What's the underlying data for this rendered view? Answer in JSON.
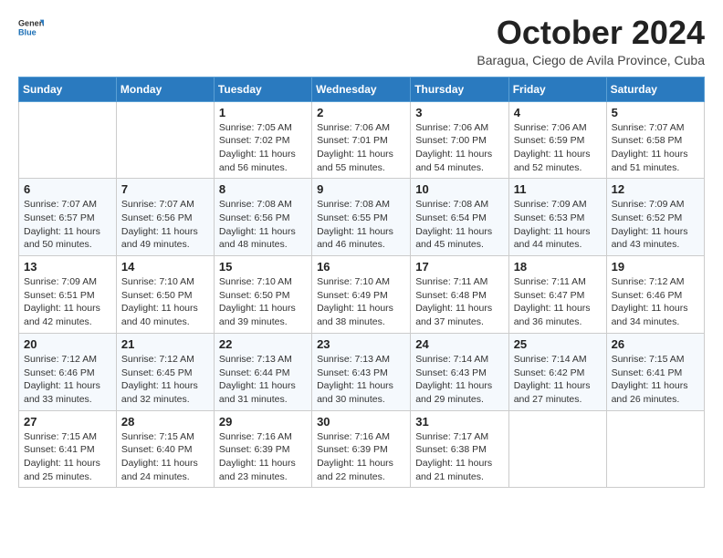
{
  "header": {
    "logo_general": "General",
    "logo_blue": "Blue",
    "title": "October 2024",
    "subtitle": "Baragua, Ciego de Avila Province, Cuba"
  },
  "days_of_week": [
    "Sunday",
    "Monday",
    "Tuesday",
    "Wednesday",
    "Thursday",
    "Friday",
    "Saturday"
  ],
  "weeks": [
    [
      {
        "day": "",
        "info": ""
      },
      {
        "day": "",
        "info": ""
      },
      {
        "day": "1",
        "sunrise": "7:05 AM",
        "sunset": "7:02 PM",
        "daylight": "11 hours and 56 minutes."
      },
      {
        "day": "2",
        "sunrise": "7:06 AM",
        "sunset": "7:01 PM",
        "daylight": "11 hours and 55 minutes."
      },
      {
        "day": "3",
        "sunrise": "7:06 AM",
        "sunset": "7:00 PM",
        "daylight": "11 hours and 54 minutes."
      },
      {
        "day": "4",
        "sunrise": "7:06 AM",
        "sunset": "6:59 PM",
        "daylight": "11 hours and 52 minutes."
      },
      {
        "day": "5",
        "sunrise": "7:07 AM",
        "sunset": "6:58 PM",
        "daylight": "11 hours and 51 minutes."
      }
    ],
    [
      {
        "day": "6",
        "sunrise": "7:07 AM",
        "sunset": "6:57 PM",
        "daylight": "11 hours and 50 minutes."
      },
      {
        "day": "7",
        "sunrise": "7:07 AM",
        "sunset": "6:56 PM",
        "daylight": "11 hours and 49 minutes."
      },
      {
        "day": "8",
        "sunrise": "7:08 AM",
        "sunset": "6:56 PM",
        "daylight": "11 hours and 48 minutes."
      },
      {
        "day": "9",
        "sunrise": "7:08 AM",
        "sunset": "6:55 PM",
        "daylight": "11 hours and 46 minutes."
      },
      {
        "day": "10",
        "sunrise": "7:08 AM",
        "sunset": "6:54 PM",
        "daylight": "11 hours and 45 minutes."
      },
      {
        "day": "11",
        "sunrise": "7:09 AM",
        "sunset": "6:53 PM",
        "daylight": "11 hours and 44 minutes."
      },
      {
        "day": "12",
        "sunrise": "7:09 AM",
        "sunset": "6:52 PM",
        "daylight": "11 hours and 43 minutes."
      }
    ],
    [
      {
        "day": "13",
        "sunrise": "7:09 AM",
        "sunset": "6:51 PM",
        "daylight": "11 hours and 42 minutes."
      },
      {
        "day": "14",
        "sunrise": "7:10 AM",
        "sunset": "6:50 PM",
        "daylight": "11 hours and 40 minutes."
      },
      {
        "day": "15",
        "sunrise": "7:10 AM",
        "sunset": "6:50 PM",
        "daylight": "11 hours and 39 minutes."
      },
      {
        "day": "16",
        "sunrise": "7:10 AM",
        "sunset": "6:49 PM",
        "daylight": "11 hours and 38 minutes."
      },
      {
        "day": "17",
        "sunrise": "7:11 AM",
        "sunset": "6:48 PM",
        "daylight": "11 hours and 37 minutes."
      },
      {
        "day": "18",
        "sunrise": "7:11 AM",
        "sunset": "6:47 PM",
        "daylight": "11 hours and 36 minutes."
      },
      {
        "day": "19",
        "sunrise": "7:12 AM",
        "sunset": "6:46 PM",
        "daylight": "11 hours and 34 minutes."
      }
    ],
    [
      {
        "day": "20",
        "sunrise": "7:12 AM",
        "sunset": "6:46 PM",
        "daylight": "11 hours and 33 minutes."
      },
      {
        "day": "21",
        "sunrise": "7:12 AM",
        "sunset": "6:45 PM",
        "daylight": "11 hours and 32 minutes."
      },
      {
        "day": "22",
        "sunrise": "7:13 AM",
        "sunset": "6:44 PM",
        "daylight": "11 hours and 31 minutes."
      },
      {
        "day": "23",
        "sunrise": "7:13 AM",
        "sunset": "6:43 PM",
        "daylight": "11 hours and 30 minutes."
      },
      {
        "day": "24",
        "sunrise": "7:14 AM",
        "sunset": "6:43 PM",
        "daylight": "11 hours and 29 minutes."
      },
      {
        "day": "25",
        "sunrise": "7:14 AM",
        "sunset": "6:42 PM",
        "daylight": "11 hours and 27 minutes."
      },
      {
        "day": "26",
        "sunrise": "7:15 AM",
        "sunset": "6:41 PM",
        "daylight": "11 hours and 26 minutes."
      }
    ],
    [
      {
        "day": "27",
        "sunrise": "7:15 AM",
        "sunset": "6:41 PM",
        "daylight": "11 hours and 25 minutes."
      },
      {
        "day": "28",
        "sunrise": "7:15 AM",
        "sunset": "6:40 PM",
        "daylight": "11 hours and 24 minutes."
      },
      {
        "day": "29",
        "sunrise": "7:16 AM",
        "sunset": "6:39 PM",
        "daylight": "11 hours and 23 minutes."
      },
      {
        "day": "30",
        "sunrise": "7:16 AM",
        "sunset": "6:39 PM",
        "daylight": "11 hours and 22 minutes."
      },
      {
        "day": "31",
        "sunrise": "7:17 AM",
        "sunset": "6:38 PM",
        "daylight": "11 hours and 21 minutes."
      },
      {
        "day": "",
        "info": ""
      },
      {
        "day": "",
        "info": ""
      }
    ]
  ],
  "labels": {
    "sunrise_prefix": "Sunrise: ",
    "sunset_prefix": "Sunset: ",
    "daylight_prefix": "Daylight: "
  }
}
